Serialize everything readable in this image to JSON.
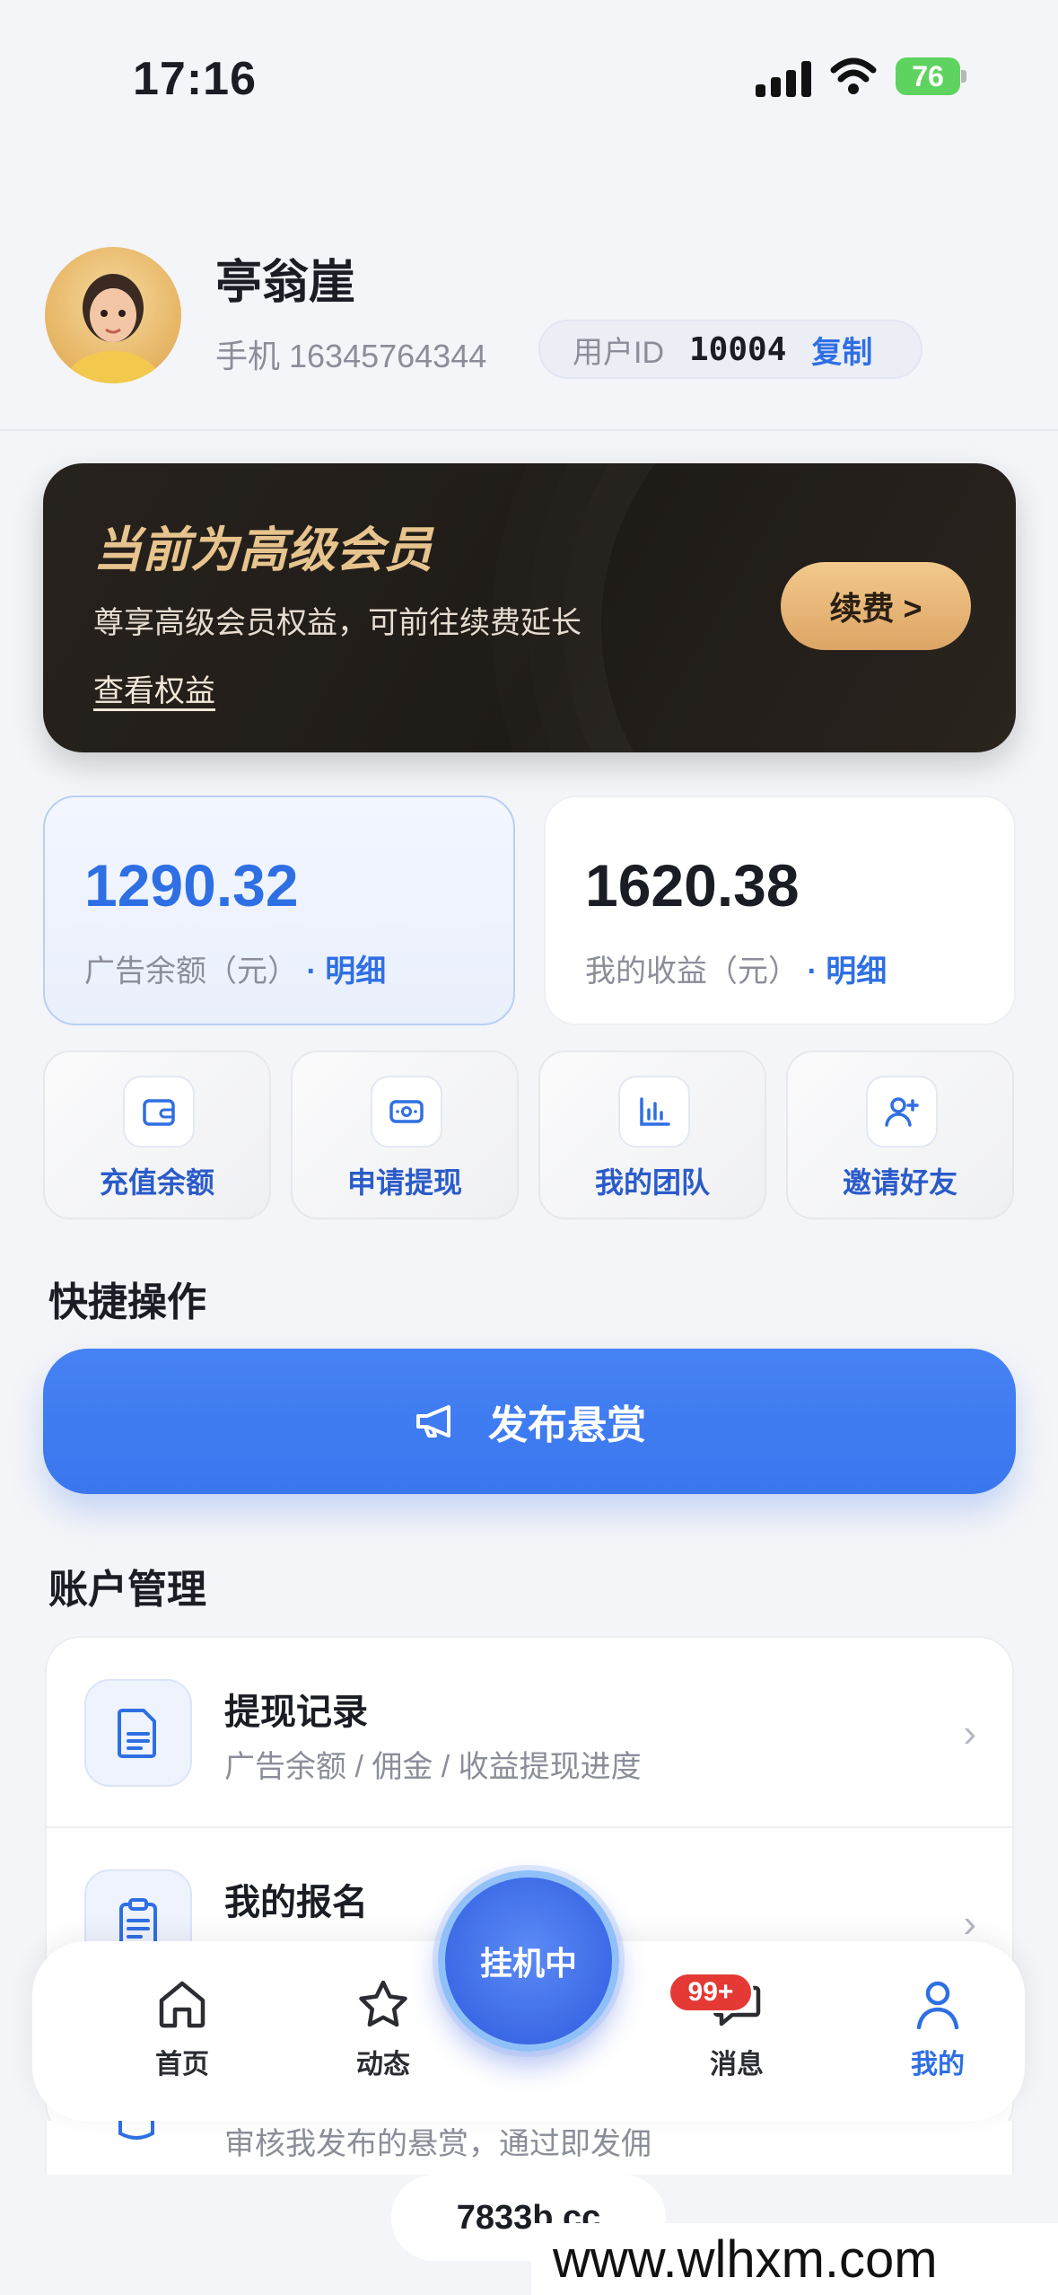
{
  "status_bar": {
    "time": "17:16",
    "battery": "76"
  },
  "profile": {
    "name": "亭翁崖",
    "phone": "手机 16345764344",
    "uid_label": "用户ID",
    "uid_value": "10004",
    "copy_label": "复制"
  },
  "vip": {
    "title": "当前为高级会员",
    "desc": "尊享高级会员权益，可前往续费延长",
    "link": "查看权益",
    "renew_label": "续费 >"
  },
  "balances": [
    {
      "amount": "1290.32",
      "label": "广告余额（元）",
      "detail": "· 明细"
    },
    {
      "amount": "1620.38",
      "label": "我的收益（元）",
      "detail": "· 明细"
    }
  ],
  "quick_actions": [
    {
      "label": "充值余额",
      "icon": "wallet-icon"
    },
    {
      "label": "申请提现",
      "icon": "cash-icon"
    },
    {
      "label": "我的团队",
      "icon": "bar-chart-icon"
    },
    {
      "label": "邀请好友",
      "icon": "add-user-icon"
    }
  ],
  "quick_section_title": "快捷操作",
  "publish_label": "发布悬赏",
  "account_section_title": "账户管理",
  "account_items": [
    {
      "title": "提现记录",
      "subtitle": "广告余额 / 佣金 / 收益提现进度"
    },
    {
      "title": "我的报名",
      "subtitle": ""
    }
  ],
  "hidden_row_text": "审核我发布的悬赏，通过即发佣",
  "tabbar": {
    "home": "首页",
    "feed": "动态",
    "center": "挂机中",
    "messages": "消息",
    "messages_badge": "99+",
    "me": "我的"
  },
  "footer_domain": "7833b.cc",
  "watermark": "www.wlhxm.com",
  "colors": {
    "accent": "#2f6fe4",
    "gold": "#e7c48e",
    "badge": "#e53935"
  }
}
